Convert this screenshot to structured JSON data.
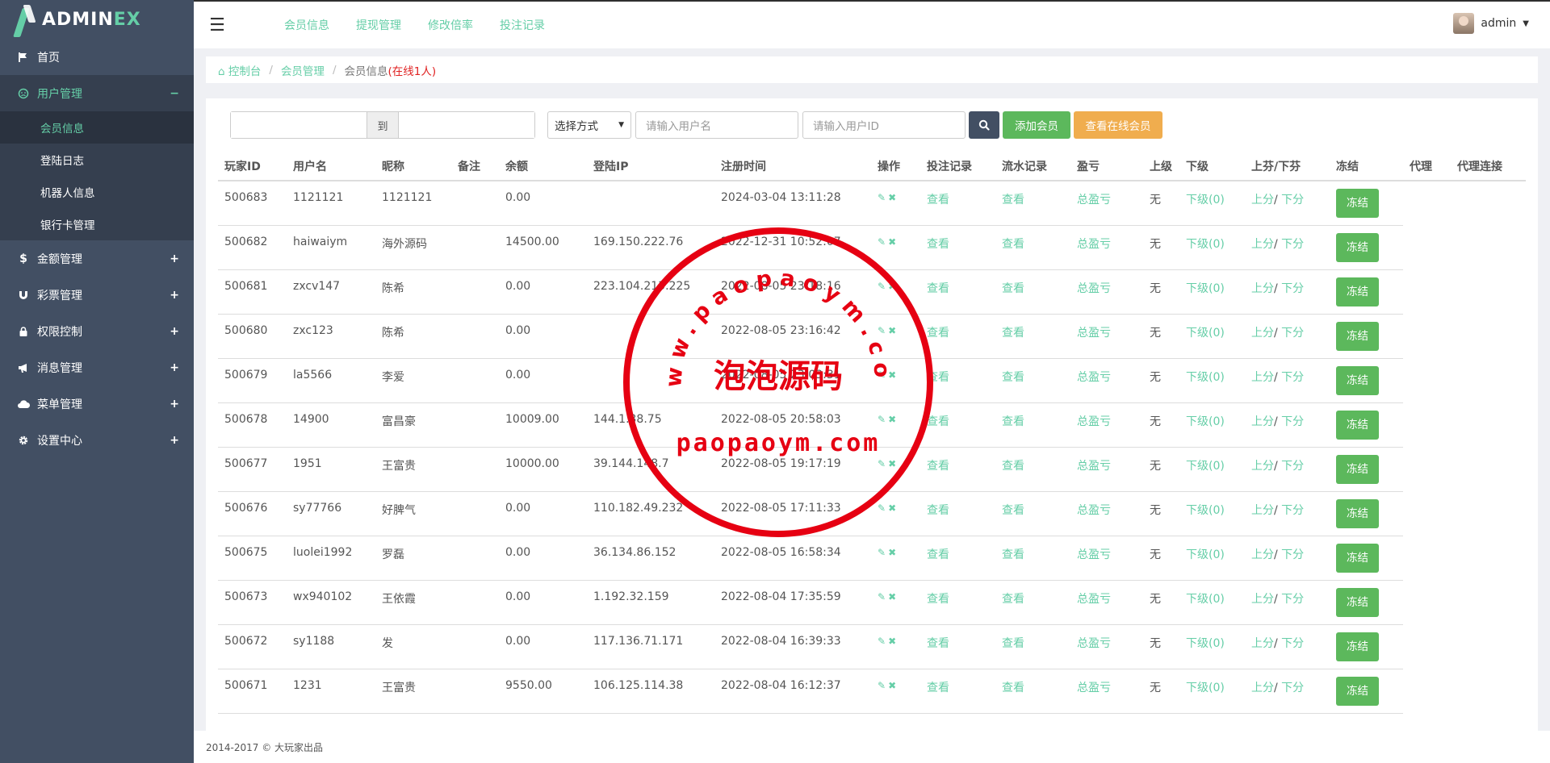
{
  "logo": {
    "prefix": "ADMIN",
    "suffix": "EX"
  },
  "sidebar": {
    "items": [
      {
        "label": "首页",
        "icon": "flag-icon"
      },
      {
        "label": "用户管理",
        "icon": "user-circle-icon",
        "toggle": "−",
        "children": [
          "会员信息",
          "登陆日志",
          "机器人信息",
          "银行卡管理"
        ]
      },
      {
        "label": "金额管理",
        "icon": "dollar-icon",
        "toggle": "+"
      },
      {
        "label": "彩票管理",
        "icon": "magnet-icon",
        "toggle": "+"
      },
      {
        "label": "权限控制",
        "icon": "lock-icon",
        "toggle": "+"
      },
      {
        "label": "消息管理",
        "icon": "bullhorn-icon",
        "toggle": "+"
      },
      {
        "label": "菜单管理",
        "icon": "cloud-icon",
        "toggle": "+"
      },
      {
        "label": "设置中心",
        "icon": "gear-icon",
        "toggle": "+"
      }
    ]
  },
  "header": {
    "nav": [
      "会员信息",
      "提现管理",
      "修改倍率",
      "投注记录"
    ],
    "user": "admin"
  },
  "breadcrumb": {
    "home": "控制台",
    "section": "会员管理",
    "current": "会员信息",
    "online": "(在线1人)"
  },
  "filters": {
    "to_label": "到",
    "select_label": "选择方式",
    "username_placeholder": "请输入用户名",
    "userid_placeholder": "请输入用户ID",
    "add_button": "添加会员",
    "online_button": "查看在线会员"
  },
  "table": {
    "headers": [
      "玩家ID",
      "用户名",
      "昵称",
      "备注",
      "余额",
      "登陆IP",
      "注册时间",
      "操作",
      "投注记录",
      "流水记录",
      "盈亏",
      "上级",
      "下级",
      "上芬/下芬",
      "冻结",
      "代理",
      "代理连接"
    ],
    "link_view": "查看",
    "link_profit": "总盈亏",
    "superior": "无",
    "lower": "下级(0)",
    "up": "上分",
    "down": "下分",
    "freeze": "冻结",
    "rows": [
      {
        "id": "500683",
        "user": "1121121",
        "nick": "1121121",
        "note": "",
        "balance": "0.00",
        "ip": "",
        "time": "2024-03-04 13:11:28"
      },
      {
        "id": "500682",
        "user": "haiwaiym",
        "nick": "海外源码",
        "note": "",
        "balance": "14500.00",
        "ip": "169.150.222.76",
        "time": "2022-12-31 10:52:07"
      },
      {
        "id": "500681",
        "user": "zxcv147",
        "nick": "陈希",
        "note": "",
        "balance": "0.00",
        "ip": "223.104.213.225",
        "time": "2022-08-05 23:18:16"
      },
      {
        "id": "500680",
        "user": "zxc123",
        "nick": "陈希",
        "note": "",
        "balance": "0.00",
        "ip": "",
        "time": "2022-08-05 23:16:42"
      },
      {
        "id": "500679",
        "user": "la5566",
        "nick": "李爱",
        "note": "",
        "balance": "0.00",
        "ip": "",
        "time": "2022-08-05 23:03:31"
      },
      {
        "id": "500678",
        "user": "14900",
        "nick": "富昌豪",
        "note": "",
        "balance": "10009.00",
        "ip": "144.1.38.75",
        "time": "2022-08-05 20:58:03"
      },
      {
        "id": "500677",
        "user": "1951",
        "nick": "王富贵",
        "note": "",
        "balance": "10000.00",
        "ip": "39.144.148.7",
        "time": "2022-08-05 19:17:19"
      },
      {
        "id": "500676",
        "user": "sy77766",
        "nick": "好脾气",
        "note": "",
        "balance": "0.00",
        "ip": "110.182.49.232",
        "time": "2022-08-05 17:11:33"
      },
      {
        "id": "500675",
        "user": "luolei1992",
        "nick": "罗磊",
        "note": "",
        "balance": "0.00",
        "ip": "36.134.86.152",
        "time": "2022-08-05 16:58:34"
      },
      {
        "id": "500673",
        "user": "wx940102",
        "nick": "王依霞",
        "note": "",
        "balance": "0.00",
        "ip": "1.192.32.159",
        "time": "2022-08-04 17:35:59"
      },
      {
        "id": "500672",
        "user": "sy1188",
        "nick": "发",
        "note": "",
        "balance": "0.00",
        "ip": "117.136.71.171",
        "time": "2022-08-04 16:39:33"
      },
      {
        "id": "500671",
        "user": "1231",
        "nick": "王富贵",
        "note": "",
        "balance": "9550.00",
        "ip": "106.125.114.38",
        "time": "2022-08-04 16:12:37"
      }
    ]
  },
  "watermark": {
    "top": "www.paopaoym.com",
    "middle": "泡泡源码",
    "bottom": "paopaoym.com",
    "color": "#e60012"
  },
  "footer": "2014-2017 © 大玩家出品",
  "colors": {
    "sidebar": "#424f63",
    "accent": "#65cea7",
    "green": "#5cb85c",
    "orange": "#f0ad4e"
  }
}
